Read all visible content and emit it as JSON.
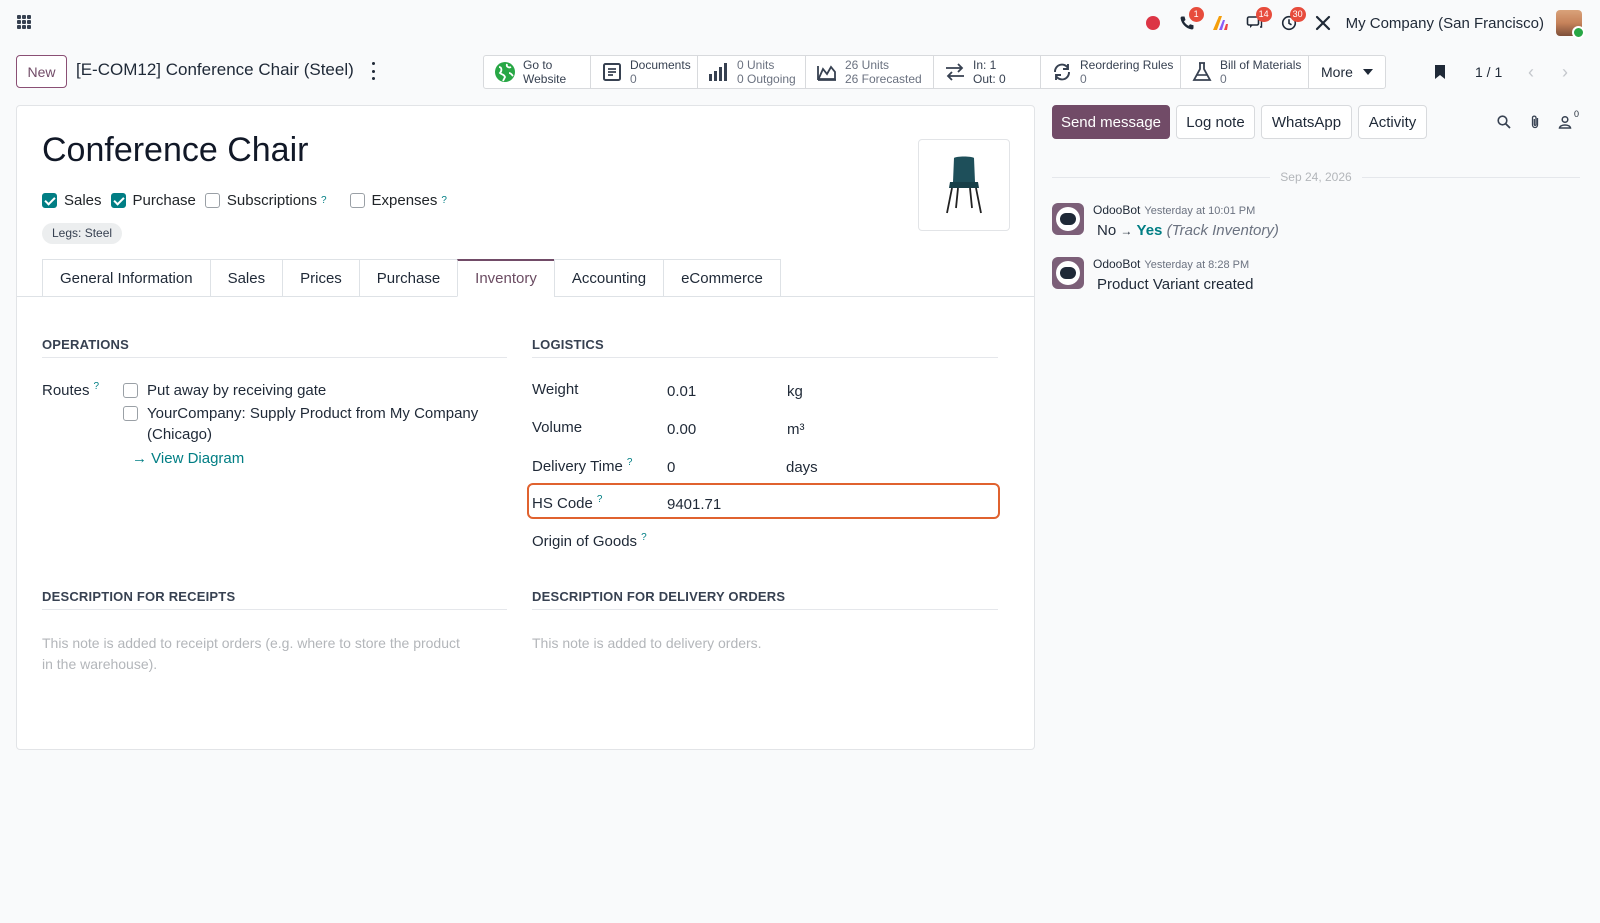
{
  "navbar": {
    "company": "My Company (San Francisco)",
    "badges": {
      "calls": "1",
      "messages": "14",
      "activities": "30"
    }
  },
  "control_panel": {
    "new_label": "New",
    "breadcrumb": "[E-COM12] Conference Chair (Steel)",
    "pager": "1 / 1",
    "smart_buttons": {
      "website": {
        "line1": "Go to",
        "line2": "Website"
      },
      "documents": {
        "line1": "Documents",
        "line2": "0"
      },
      "units": {
        "line1": "0 Units",
        "line2": "0 Outgoing"
      },
      "forecast": {
        "line1": "26 Units",
        "line2": "26 Forecasted"
      },
      "inout": {
        "line1": "In: 1",
        "line2": "Out: 0"
      },
      "reordering": {
        "line1": "Reordering Rules",
        "line2": "0"
      },
      "bom": {
        "line1": "Bill of Materials",
        "line2": "0"
      },
      "more": "More"
    }
  },
  "form": {
    "title": "Conference Chair",
    "checkboxes": [
      {
        "label": "Sales",
        "checked": true
      },
      {
        "label": "Purchase",
        "checked": true
      },
      {
        "label": "Subscriptions",
        "checked": false
      },
      {
        "label": "Expenses",
        "checked": false
      }
    ],
    "help_mark": "?",
    "tag": "Legs: Steel",
    "tabs": [
      "General Information",
      "Sales",
      "Prices",
      "Purchase",
      "Inventory",
      "Accounting",
      "eCommerce"
    ],
    "active_tab": "Inventory",
    "operations": {
      "title": "OPERATIONS",
      "routes_label": "Routes",
      "route1": "Put away by receiving gate",
      "route2_line1": "YourCompany: Supply Product from My Company",
      "route2_line2": "(Chicago)",
      "view_diagram": "View Diagram"
    },
    "logistics": {
      "title": "LOGISTICS",
      "weight_label": "Weight",
      "weight_value": "0.01",
      "weight_unit": "kg",
      "volume_label": "Volume",
      "volume_value": "0.00",
      "volume_unit": "m³",
      "delivery_label": "Delivery Time",
      "delivery_value": "0",
      "delivery_unit": "days",
      "hs_label": "HS Code",
      "hs_value": "9401.71",
      "origin_label": "Origin of Goods"
    },
    "receipts": {
      "title": "DESCRIPTION FOR RECEIPTS",
      "placeholder_line1": "This note is added to receipt orders (e.g. where to store the product",
      "placeholder_line2": "in the warehouse)."
    },
    "delivery": {
      "title": "DESCRIPTION FOR DELIVERY ORDERS",
      "placeholder": "This note is added to delivery orders."
    }
  },
  "chatter": {
    "send_message": "Send message",
    "log_note": "Log note",
    "whatsapp": "WhatsApp",
    "activity": "Activity",
    "follower_count": "0",
    "date_separator": "Sep 24, 2026",
    "messages": [
      {
        "author": "OdooBot",
        "time": "Yesterday at 10:01 PM",
        "old": "No",
        "arrow": "→",
        "new": "Yes",
        "field": "(Track Inventory)"
      },
      {
        "author": "OdooBot",
        "time": "Yesterday at 8:28 PM",
        "body": "Product Variant created"
      }
    ]
  },
  "colors": {
    "brand": "#714b67",
    "accent": "#017e84",
    "highlight": "#e0622f"
  }
}
